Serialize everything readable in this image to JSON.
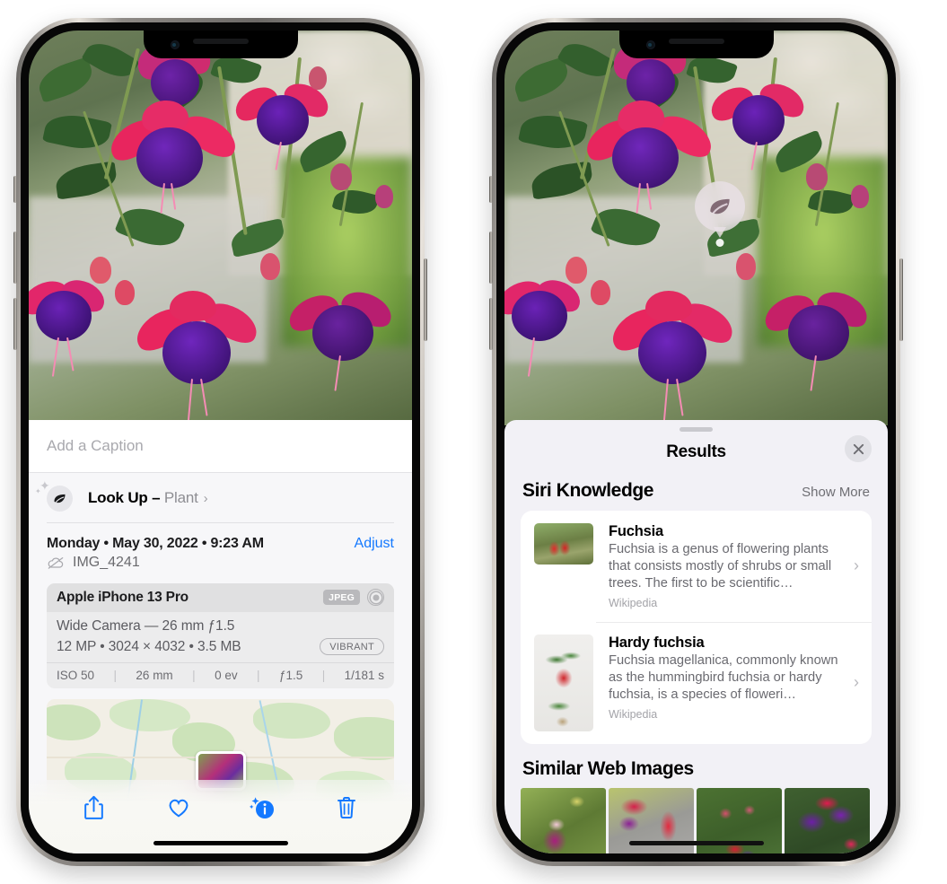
{
  "left_phone": {
    "name": "photos-info-screen",
    "caption": {
      "placeholder": "Add a Caption",
      "value": ""
    },
    "lookup": {
      "label": "Look Up –",
      "kind": "Plant",
      "chevron": "›",
      "icon": "leaf-icon",
      "sparkle": "✦",
      "sparkle_small": "✦"
    },
    "date": {
      "text": "Monday • May 30, 2022 • 9:23 AM",
      "adjust_label": "Adjust",
      "file_name": "IMG_4241",
      "cloud_icon": "cloud-slash-icon"
    },
    "camera_card": {
      "model": "Apple iPhone 13 Pro",
      "format_badge": "JPEG",
      "hdr_icon": "hdr-ring-icon",
      "lens_line": "Wide Camera — 26 mm ƒ1.5",
      "specs_line": "12 MP • 3024 × 4032 • 3.5 MB",
      "style_badge": "VIBRANT",
      "exif": [
        {
          "label": "ISO 50"
        },
        {
          "label": "26 mm"
        },
        {
          "label": "0 ev"
        },
        {
          "label": "ƒ1.5"
        },
        {
          "label": "1/181 s"
        }
      ]
    },
    "toolbar": [
      {
        "name": "share-button",
        "icon": "share-icon"
      },
      {
        "name": "favorite-button",
        "icon": "heart-icon"
      },
      {
        "name": "info-button",
        "icon": "info-sparkle-icon"
      },
      {
        "name": "delete-button",
        "icon": "trash-icon"
      }
    ],
    "accent_color": "#1479ff"
  },
  "right_phone": {
    "name": "visual-lookup-results-screen",
    "leaf_badge": {
      "icon": "leaf-icon"
    },
    "sheet": {
      "title": "Results",
      "close_icon": "close-icon",
      "grabber": "drag-handle"
    },
    "siri_knowledge": {
      "title": "Siri Knowledge",
      "show_more": "Show More",
      "items": [
        {
          "title": "Fuchsia",
          "description": "Fuchsia is a genus of flowering plants that consists mostly of shrubs or small trees. The first to be scientific…",
          "source": "Wikipedia",
          "chevron": "›"
        },
        {
          "title": "Hardy fuchsia",
          "description": "Fuchsia magellanica, commonly known as the hummingbird fuchsia or hardy fuchsia, is a species of floweri…",
          "source": "Wikipedia",
          "chevron": "›"
        }
      ]
    },
    "similar_web_images": {
      "title": "Similar Web Images",
      "items": [
        {
          "alt": "fuchsia-thumbnail-1"
        },
        {
          "alt": "fuchsia-thumbnail-2"
        },
        {
          "alt": "fuchsia-thumbnail-3"
        },
        {
          "alt": "fuchsia-thumbnail-4"
        }
      ]
    }
  }
}
